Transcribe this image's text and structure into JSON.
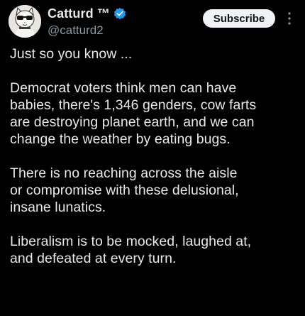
{
  "author": {
    "display_name": "Catturd ™",
    "handle": "@catturd2",
    "avatar_icon": "cat-avatar-icon",
    "verified_icon": "verified-badge-icon",
    "verified_color": "#1d9bf0"
  },
  "actions": {
    "subscribe_label": "Subscribe",
    "more_icon": "more-options-icon"
  },
  "tweet": {
    "paragraphs": [
      {
        "lines": [
          "Just so you know ..."
        ]
      },
      {
        "lines": [
          "Democrat voters think men can have",
          "babies, there's 1,346 genders, cow farts",
          "are destroying planet earth, and we can",
          "change the weather by eating bugs."
        ]
      },
      {
        "lines": [
          "There is no reaching across the aisle",
          "or compromise with these delusional,",
          "insane lunatics."
        ]
      },
      {
        "lines": [
          "Liberalism is to be mocked, laughed at,",
          "and defeated at every turn."
        ]
      }
    ]
  },
  "colors": {
    "background": "#000000",
    "text": "#e7e9ea",
    "secondary_text": "#8b98a5",
    "button_bg": "#eff3f4"
  }
}
